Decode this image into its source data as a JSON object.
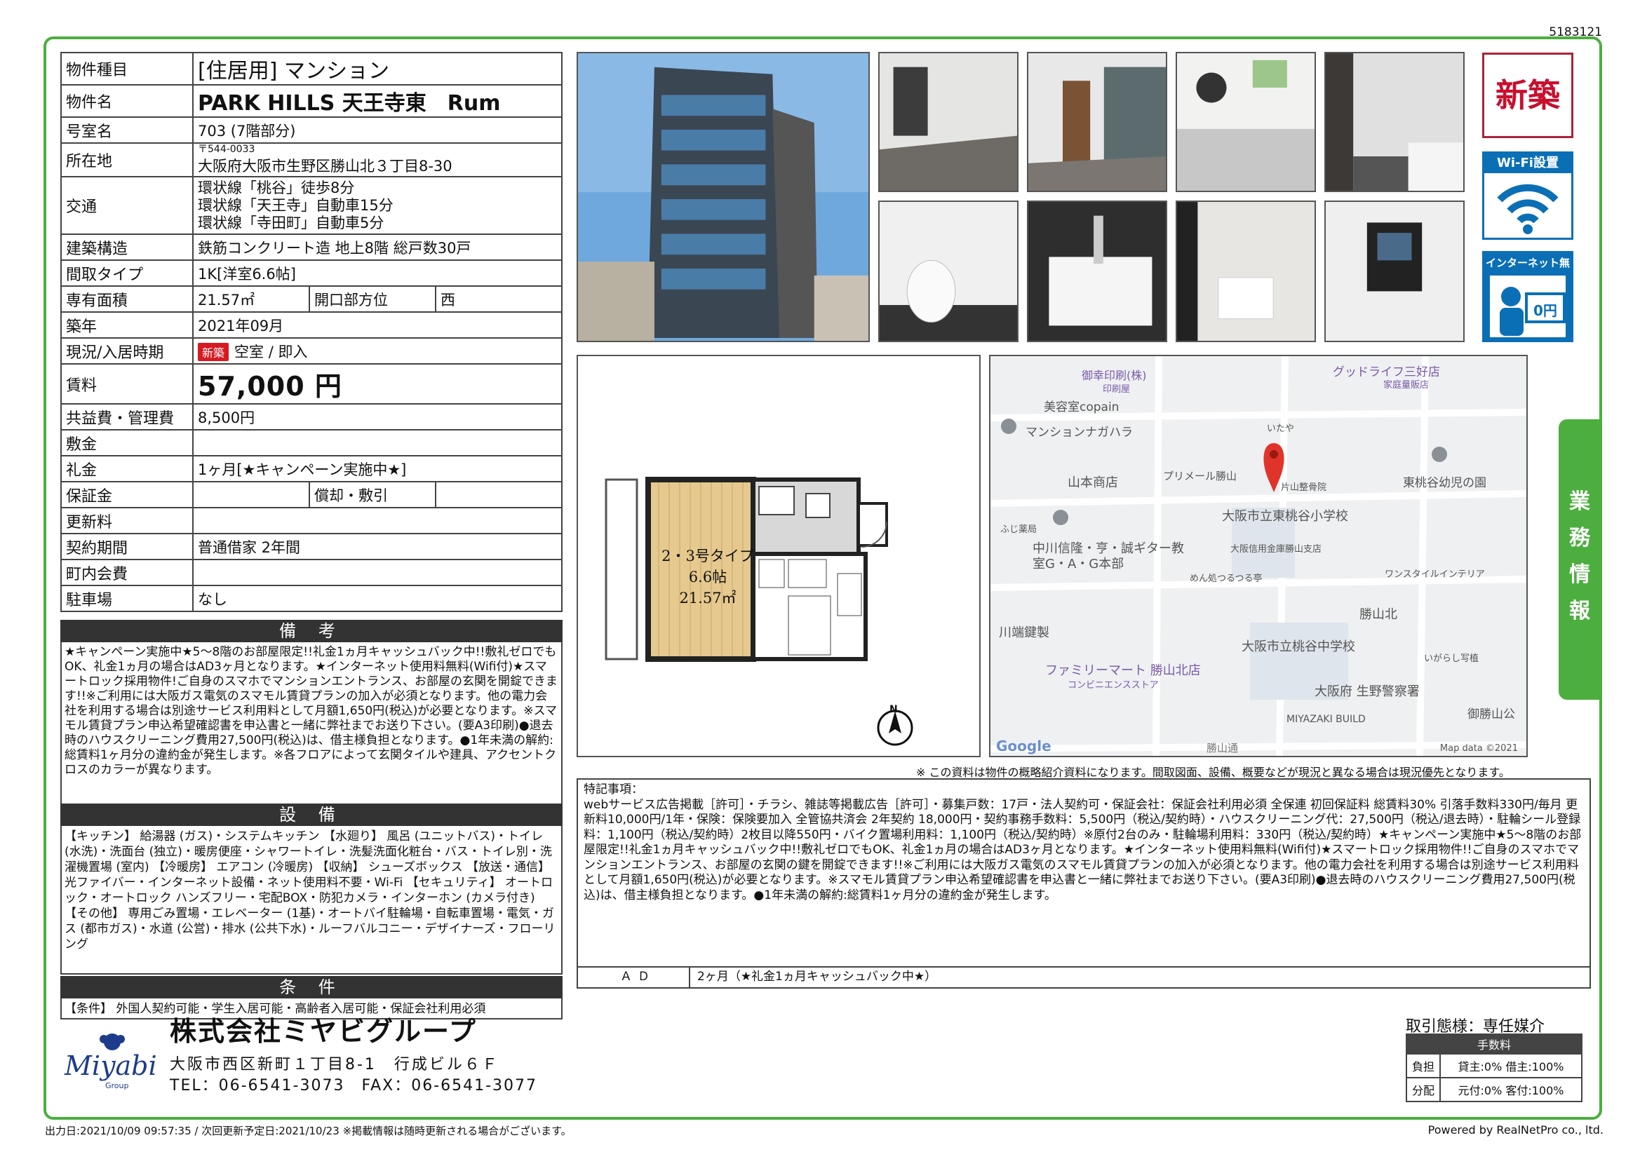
{
  "doc_id": "5183121",
  "property": {
    "rows": [
      {
        "label": "物件種目",
        "value": "[住居用] マンション"
      },
      {
        "label": "物件名",
        "value": "PARK HILLS 天王寺東　Rum"
      },
      {
        "label": "号室名",
        "value": "703 (7階部分)"
      },
      {
        "label": "所在地",
        "postal": "〒544-0033",
        "value": "大阪府大阪市生野区勝山北３丁目8-30"
      },
      {
        "label": "交通",
        "lines": [
          "環状線「桃谷」徒歩8分",
          "環状線「天王寺」自動車15分",
          "環状線「寺田町」自動車5分"
        ]
      },
      {
        "label": "建築構造",
        "value": "鉄筋コンクリート造 地上8階 総戸数30戸"
      },
      {
        "label": "間取タイプ",
        "value": "1K[洋室6.6帖]"
      },
      {
        "label": "専有面積",
        "value": "21.57㎡",
        "sub_label": "開口部方位",
        "sub_value": "西"
      },
      {
        "label": "築年",
        "value": "2021年09月"
      },
      {
        "label": "現況/入居時期",
        "badge": "新築",
        "value": "空室 / 即入"
      },
      {
        "label": "賃料",
        "value": "57,000 円"
      },
      {
        "label": "共益費・管理費",
        "value": "8,500円"
      },
      {
        "label": "敷金",
        "value": ""
      },
      {
        "label": "礼金",
        "value": "1ヶ月[★キャンペーン実施中★]"
      },
      {
        "label": "保証金",
        "value": "",
        "sub_label": "償却・敷引",
        "sub_value": ""
      },
      {
        "label": "更新料",
        "value": ""
      },
      {
        "label": "契約期間",
        "value": "普通借家 2年間"
      },
      {
        "label": "町内会費",
        "value": ""
      },
      {
        "label": "駐車場",
        "value": "なし"
      }
    ]
  },
  "remarks": {
    "title": "備 考",
    "text": "★キャンペーン実施中★5～8階のお部屋限定!!礼金1ヵ月キャッシュバック中!!敷礼ゼロでもOK、礼金1ヵ月の場合はAD3ヶ月となります。★インターネット使用料無料(Wifi付)★スマートロック採用物件!ご自身のスマホでマンションエントランス、お部屋の玄関を開錠できます!!※ご利用には大阪ガス電気のスマモル賃貸プランの加入が必須となります。他の電力会社を利用する場合は別途サービス利用料として月額1,650円(税込)が必要となります。※スマモル賃貸プラン申込希望確認書を申込書と一緒に弊社までお送り下さい。(要A3印刷)●退去時のハウスクリーニング費用27,500円(税込)は、借主様負担となります。●1年未満の解約:総賃料1ヶ月分の違約金が発生します。※各フロアによって玄関タイルや建具、アクセントクロスのカラーが異なります。"
  },
  "equipment": {
    "title": "設 備",
    "text": "【キッチン】 給湯器 (ガス)・システムキッチン 【水廻り】 風呂 (ユニットバス)・トイレ (水洗)・洗面台 (独立)・暖房便座・シャワートイレ・洗髪洗面化粧台・バス・トイレ別・洗濯機置場 (室内) 【冷暖房】 エアコン (冷暖房) 【収納】 シューズボックス 【放送・通信】 光ファイバー・インターネット設備・ネット使用料不要・Wi-Fi 【セキュリティ】 オートロック・オートロック ハンズフリー・宅配BOX・防犯カメラ・インターホン (カメラ付き) 【その他】 専用ごみ置場・エレベーター (1基)・オートバイ駐輪場・自転車置場・電気・ガス (都市ガス)・水道 (公営)・排水 (公共下水)・ルーフバルコニー・デザイナーズ・フローリング"
  },
  "conditions": {
    "title": "条 件",
    "text": "【条件】 外国人契約可能・学生入居可能・高齢者入居可能・保証会社利用必須"
  },
  "badges": {
    "new": "新築",
    "wifi": "Wi-Fi設置",
    "net_title": "インターネット無料",
    "net_price": "0円"
  },
  "side_tab": [
    "業",
    "務",
    "情",
    "報"
  ],
  "floorplan": {
    "type_label": "2・3号タイプ",
    "size_label": "6.6帖",
    "area_label": "21.57㎡",
    "north": "N"
  },
  "map": {
    "labels": [
      "御幸印刷(株)",
      "印刷屋",
      "グッドライフ三好店",
      "家庭量販店",
      "美容室copain",
      "マンションナガハラ",
      "いたや",
      "山本商店",
      "プリメール勝山",
      "片山整骨院",
      "東桃谷幼児の園",
      "ふじ薬局",
      "大阪市立東桃谷小学校",
      "中川信隆・亨・誠ギター教室G・A・G本部",
      "大阪信用金庫勝山支店",
      "めん処つるつる亭",
      "ワンスタイルインテリア",
      "勝山北",
      "川端鍵製",
      "大阪市立桃谷中学校",
      "ファミリーマート 勝山北店",
      "コンビニエンスストア",
      "いがらし写植",
      "大阪府 生野警察署",
      "御勝山公",
      "MIYAZAKI BUILD",
      "勝山通",
      "Google",
      "Map data ©2021"
    ]
  },
  "disclaimer": "※ この資料は物件の概略紹介資料になります。間取図面、設備、概要などが現況と異なる場合は現況優先となります。",
  "special": {
    "title": "特記事項：",
    "text": "webサービス広告掲載［許可］・チラシ、雑誌等掲載広告［許可］・募集戸数：17戸・法人契約可・保証会社：保証会社利用必須 全保連 初回保証料 総賃料30% 引落手数料330円/毎月 更新料10,000円/1年・保険：保険要加入 全管協共済会 2年契約 18,000円・契約事務手数料：5,500円（税込/契約時）・ハウスクリーニング代：27,500円（税込/退去時）・駐輪シール登録料：1,100円（税込/契約時）2枚目以降550円・バイク置場利用料：1,100円（税込/契約時）※原付2台のみ・駐輪場利用料：330円（税込/契約時）★キャンペーン実施中★5～8階のお部屋限定!!礼金1ヵ月キャッシュバック中!!敷礼ゼロでもOK、礼金1ヵ月の場合はAD3ヶ月となります。★インターネット使用料無料(Wifi付)★スマートロック採用物件!!ご自身のスマホでマンションエントランス、お部屋の玄関の鍵を開錠できます!!※ご利用には大阪ガス電気のスマモル賃貸プランの加入が必須となります。他の電力会社を利用する場合は別途サービス利用料として月額1,650円(税込)が必要となります。※スマモル賃貸プラン申込希望確認書を申込書と一緒に弊社までお送り下さい。(要A3印刷)●退去時のハウスクリーニング費用27,500円(税込)は、借主様負担となります。●1年未満の解約:総賃料1ヶ月分の違約金が発生します。"
  },
  "ad": {
    "label": "ＡＤ",
    "value": "2ヶ月（★礼金1ヵ月キャッシュバック中★）"
  },
  "company": {
    "logo_text": "Miyabi",
    "logo_sub": "Group",
    "name": "株式会社ミヤビグループ",
    "address": "大阪市西区新町１丁目8-1　行成ビル６Ｆ",
    "tel": "TEL：06-6541-3073　FAX：06-6541-3077"
  },
  "transaction": {
    "type": "取引態様：専任媒介",
    "fee_header": "手数料",
    "rows": [
      {
        "label": "負担",
        "value": "貸主:0% 借主:100%"
      },
      {
        "label": "分配",
        "value": "元付:0% 客付:100%"
      }
    ]
  },
  "footer": {
    "left": "出力日:2021/10/09 09:57:35 / 次回更新予定日:2021/10/23 ※掲載情報は随時更新される場合がございます。",
    "right": "Powered by RealNetPro co., ltd."
  },
  "colors": {
    "frame_green": "#4cae3f",
    "badge_red": "#c8102e",
    "badge_blue": "#0b6fb6"
  }
}
